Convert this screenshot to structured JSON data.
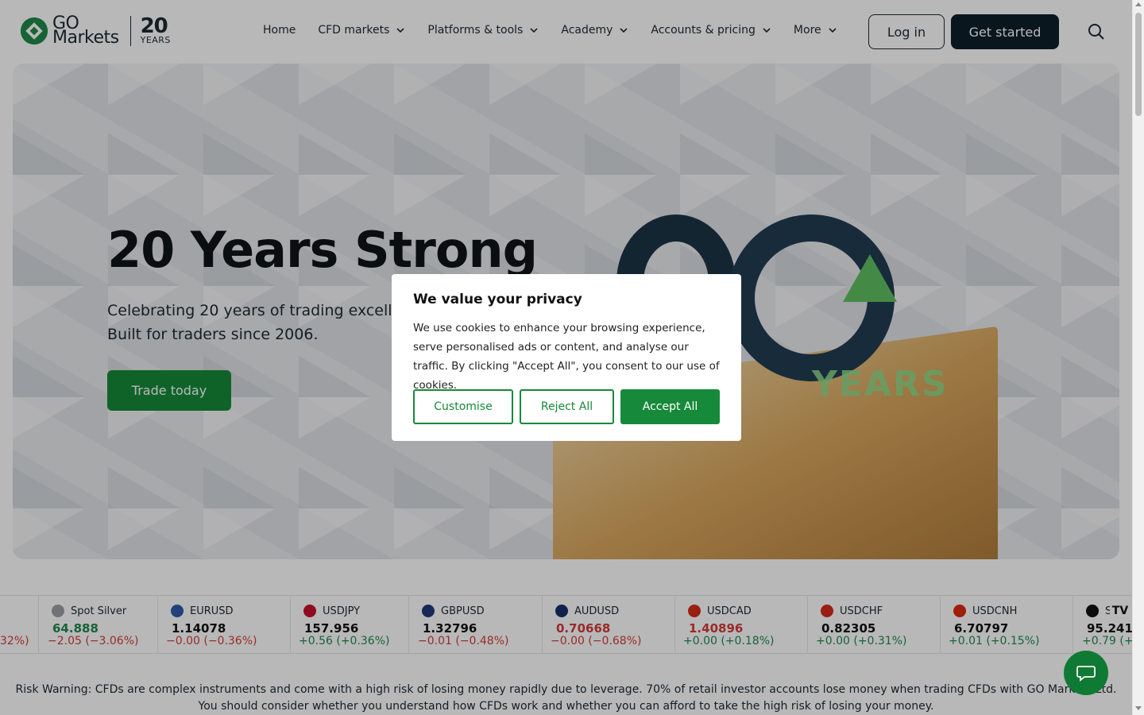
{
  "header": {
    "logo_text_line1": "GO",
    "logo_text_line2": "Markets",
    "logo_20": "20",
    "logo_years": "YEARS",
    "nav": [
      {
        "label": "Home",
        "dropdown": false
      },
      {
        "label": "CFD markets",
        "dropdown": true
      },
      {
        "label": "Platforms & tools",
        "dropdown": true
      },
      {
        "label": "Academy",
        "dropdown": true
      },
      {
        "label": "Accounts & pricing",
        "dropdown": true
      },
      {
        "label": "More",
        "dropdown": true
      }
    ],
    "login_label": "Log in",
    "get_started_label": "Get started"
  },
  "hero": {
    "title": "20 Years Strong",
    "subtitle_line1": "Celebrating 20 years of trading excellen",
    "subtitle_line2": "Built for traders since 2006.",
    "cta_label": "Trade today",
    "graphic_text": "YEARS"
  },
  "ticker": [
    {
      "symbol": "",
      "price": "",
      "change": "32%)",
      "dir": "neg",
      "flag": ""
    },
    {
      "symbol": "Spot Silver",
      "price": "64.888",
      "change": "−2.05 (−3.06%)",
      "dir": "neg",
      "price_dir": "pos",
      "flag": "#9aa0a6"
    },
    {
      "symbol": "EURUSD",
      "price": "1.14078",
      "change": "−0.00 (−0.36%)",
      "dir": "neg",
      "price_dir": "dark",
      "flag": "#2f5aa8"
    },
    {
      "symbol": "USDJPY",
      "price": "157.956",
      "change": "+0.56 (+0.36%)",
      "dir": "pos",
      "price_dir": "dark",
      "flag": "#c8102e"
    },
    {
      "symbol": "GBPUSD",
      "price": "1.32796",
      "change": "−0.01 (−0.48%)",
      "dir": "neg",
      "price_dir": "dark",
      "flag": "#1f3a7a"
    },
    {
      "symbol": "AUDUSD",
      "price": "0.70668",
      "change": "−0.00 (−0.68%)",
      "dir": "neg",
      "price_dir": "neg",
      "flag": "#14306b"
    },
    {
      "symbol": "USDCAD",
      "price": "1.40896",
      "change": "+0.00 (+0.18%)",
      "dir": "pos",
      "price_dir": "neg",
      "flag": "#d52b1e"
    },
    {
      "symbol": "USDCHF",
      "price": "0.82305",
      "change": "+0.00 (+0.31%)",
      "dir": "pos",
      "price_dir": "dark",
      "flag": "#d52b1e"
    },
    {
      "symbol": "USDCNH",
      "price": "6.70797",
      "change": "+0.01 (+0.15%)",
      "dir": "pos",
      "price_dir": "dark",
      "flag": "#de2910"
    },
    {
      "symbol": "S",
      "price": "95.241",
      "change": "+0.79 (+",
      "dir": "pos",
      "price_dir": "dark",
      "flag": "#111111"
    }
  ],
  "tradingview_mark": "TV",
  "risk_warning": "Risk Warning: CFDs are complex instruments and come with a high risk of losing money rapidly due to leverage. 70% of retail investor accounts lose money when trading CFDs with GO Markets Ltd. You should consider whether you understand how CFDs work and whether you can afford to take the high risk of losing your money.",
  "cookie": {
    "title": "We value your privacy",
    "body": "We use cookies to enhance your browsing experience, serve personalised ads or content, and analyse our traffic. By clicking \"Accept All\", you consent to our use of cookies.",
    "customise_label": "Customise",
    "reject_label": "Reject All",
    "accept_label": "Accept All"
  },
  "colors": {
    "brand_green": "#168a3a",
    "brand_dark": "#0e1f29",
    "positive": "#1f8a4c",
    "negative": "#d43b3b"
  }
}
